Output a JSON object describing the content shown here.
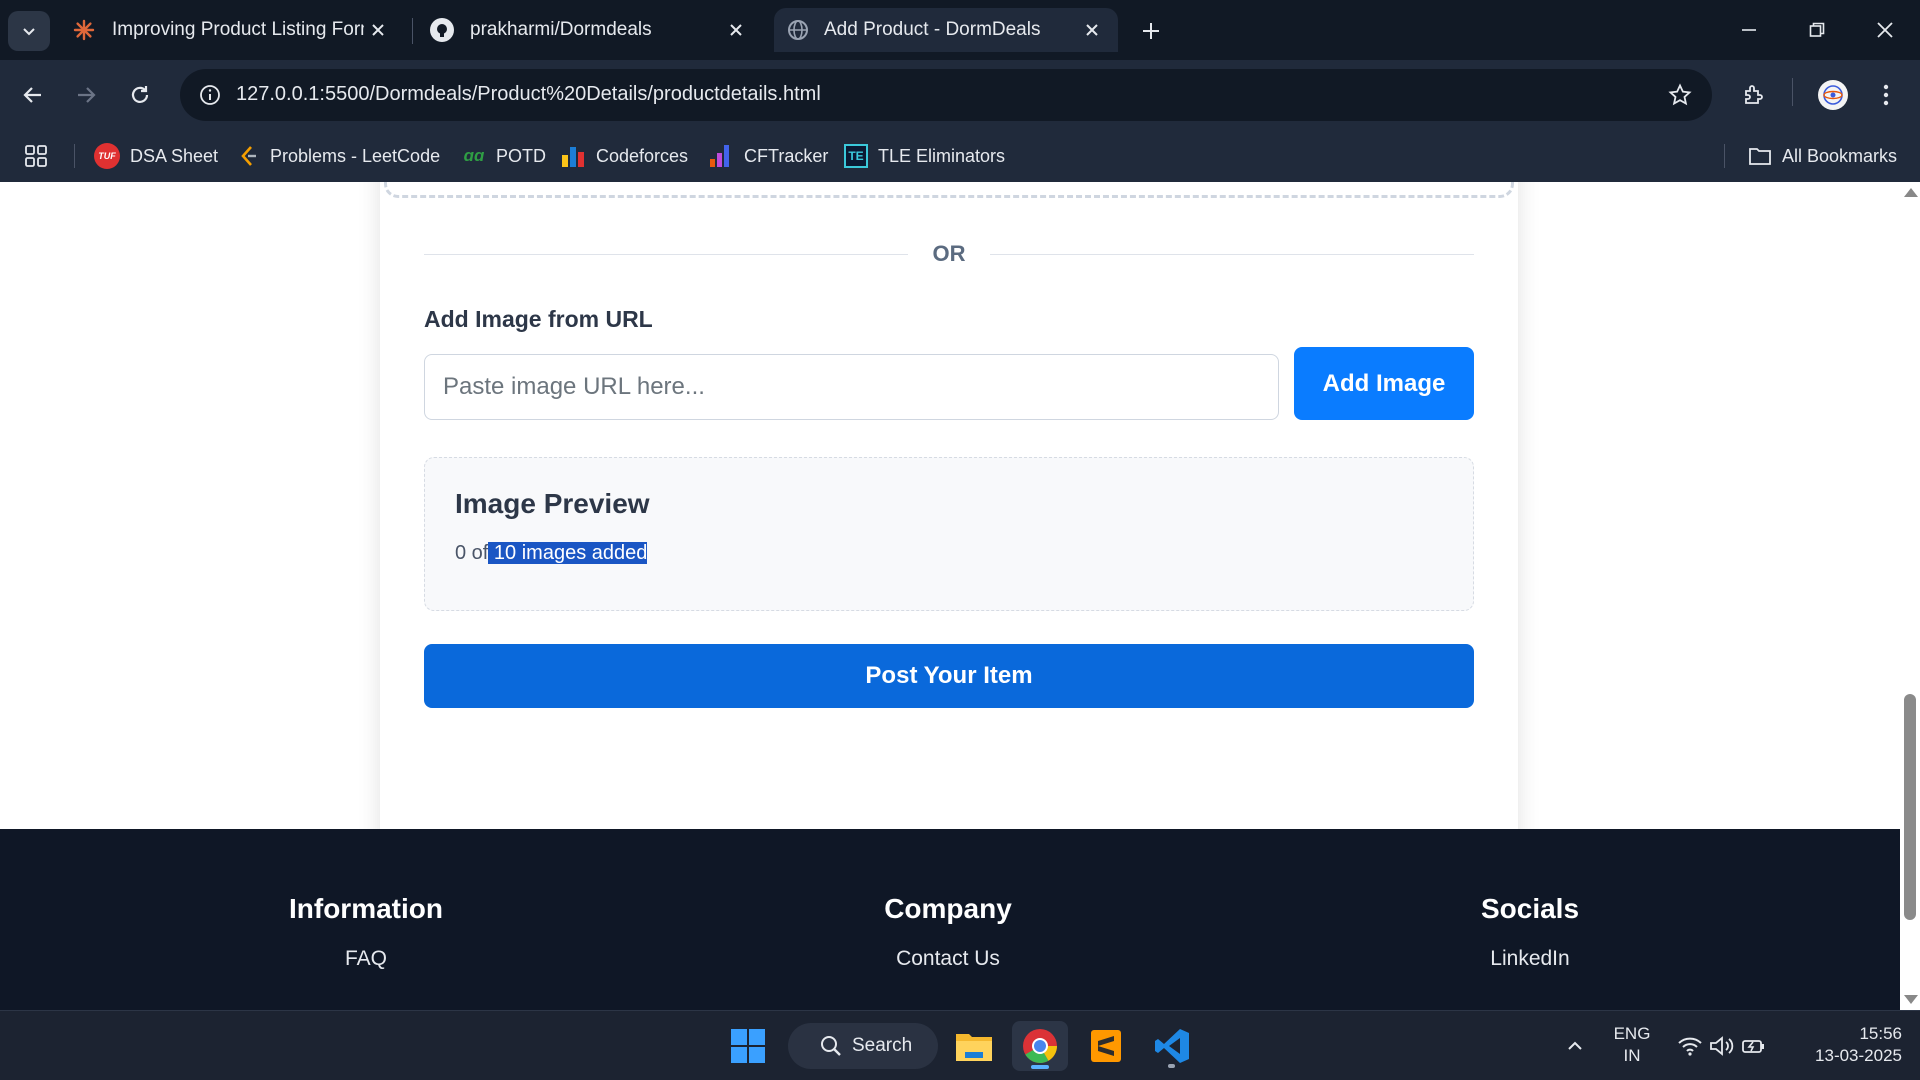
{
  "browser": {
    "tabs": [
      {
        "title": "Improving Product Listing Form",
        "icon": "asterisk-icon",
        "active": false
      },
      {
        "title": "prakharmi/Dormdeals",
        "icon": "github-icon",
        "active": false
      },
      {
        "title": "Add Product - DormDeals",
        "icon": "globe-icon",
        "active": true
      }
    ],
    "url": "127.0.0.1:5500/Dormdeals/Product%20Details/productdetails.html",
    "bookmarks": [
      {
        "label": "DSA Sheet",
        "icon": "tuf-icon"
      },
      {
        "label": "Problems - LeetCode",
        "icon": "leetcode-icon"
      },
      {
        "label": "POTD",
        "icon": "gfg-icon"
      },
      {
        "label": "Codeforces",
        "icon": "codeforces-icon"
      },
      {
        "label": "CFTracker",
        "icon": "cftracker-icon"
      },
      {
        "label": "TLE Eliminators",
        "icon": "tle-icon"
      }
    ],
    "all_bookmarks_label": "All Bookmarks"
  },
  "form": {
    "or_text": "OR",
    "url_label": "Add Image from URL",
    "url_placeholder": "Paste image URL here...",
    "url_value": "",
    "add_image_label": "Add Image",
    "preview_title": "Image Preview",
    "preview_count_prefix": "0 of",
    "preview_count_selected": " 10 images added",
    "post_label": "Post Your Item"
  },
  "footer": {
    "columns": [
      {
        "heading": "Information",
        "link": "FAQ"
      },
      {
        "heading": "Company",
        "link": "Contact Us"
      },
      {
        "heading": "Socials",
        "link": "LinkedIn"
      }
    ]
  },
  "taskbar": {
    "search_label": "Search",
    "language_line1": "ENG",
    "language_line2": "IN",
    "time": "15:56",
    "date": "13-03-2025"
  },
  "colors": {
    "chrome_bg": "#202a3b",
    "tabstrip_bg": "#111925",
    "primary_button": "#0a7cff",
    "post_button": "#0a69db",
    "footer_bg": "#0f1726",
    "selection": "#1a56c4"
  }
}
